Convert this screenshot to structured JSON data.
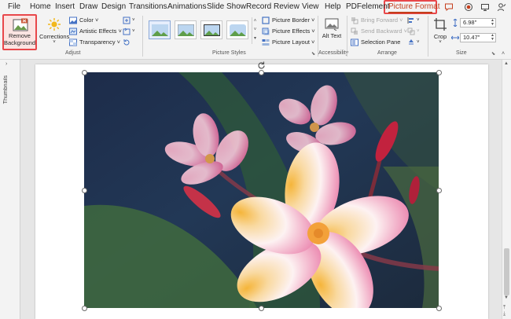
{
  "menu": {
    "tabs": [
      "File",
      "Home",
      "Insert",
      "Draw",
      "Design",
      "Transitions",
      "Animations",
      "Slide Show",
      "Record",
      "Review",
      "View",
      "Help",
      "PDFelement",
      "Picture Format"
    ],
    "active_tab": "Picture Format",
    "accent_color": "#c43e1c",
    "highlight_color": "#e8474a"
  },
  "ribbon": {
    "adjust": {
      "remove_background": "Remove Background",
      "corrections": "Corrections",
      "color": "Color ˅",
      "artistic_effects": "Artistic Effects ˅",
      "transparency": "Transparency ˅",
      "label": "Adjust"
    },
    "picture_styles": {
      "border": "Picture Border ˅",
      "effects": "Picture Effects ˅",
      "layout": "Picture Layout ˅",
      "label": "Picture Styles"
    },
    "accessibility": {
      "alt_text": "Alt Text",
      "label": "Accessibility"
    },
    "arrange": {
      "bring_forward": "Bring Forward ˅",
      "send_backward": "Send Backward ˅",
      "selection_pane": "Selection Pane",
      "label": "Arrange"
    },
    "size": {
      "crop": "Crop",
      "height": "6.98\"",
      "width": "10.47\"",
      "label": "Size"
    }
  },
  "workspace": {
    "thumbnails_label": "Thumbnails"
  }
}
